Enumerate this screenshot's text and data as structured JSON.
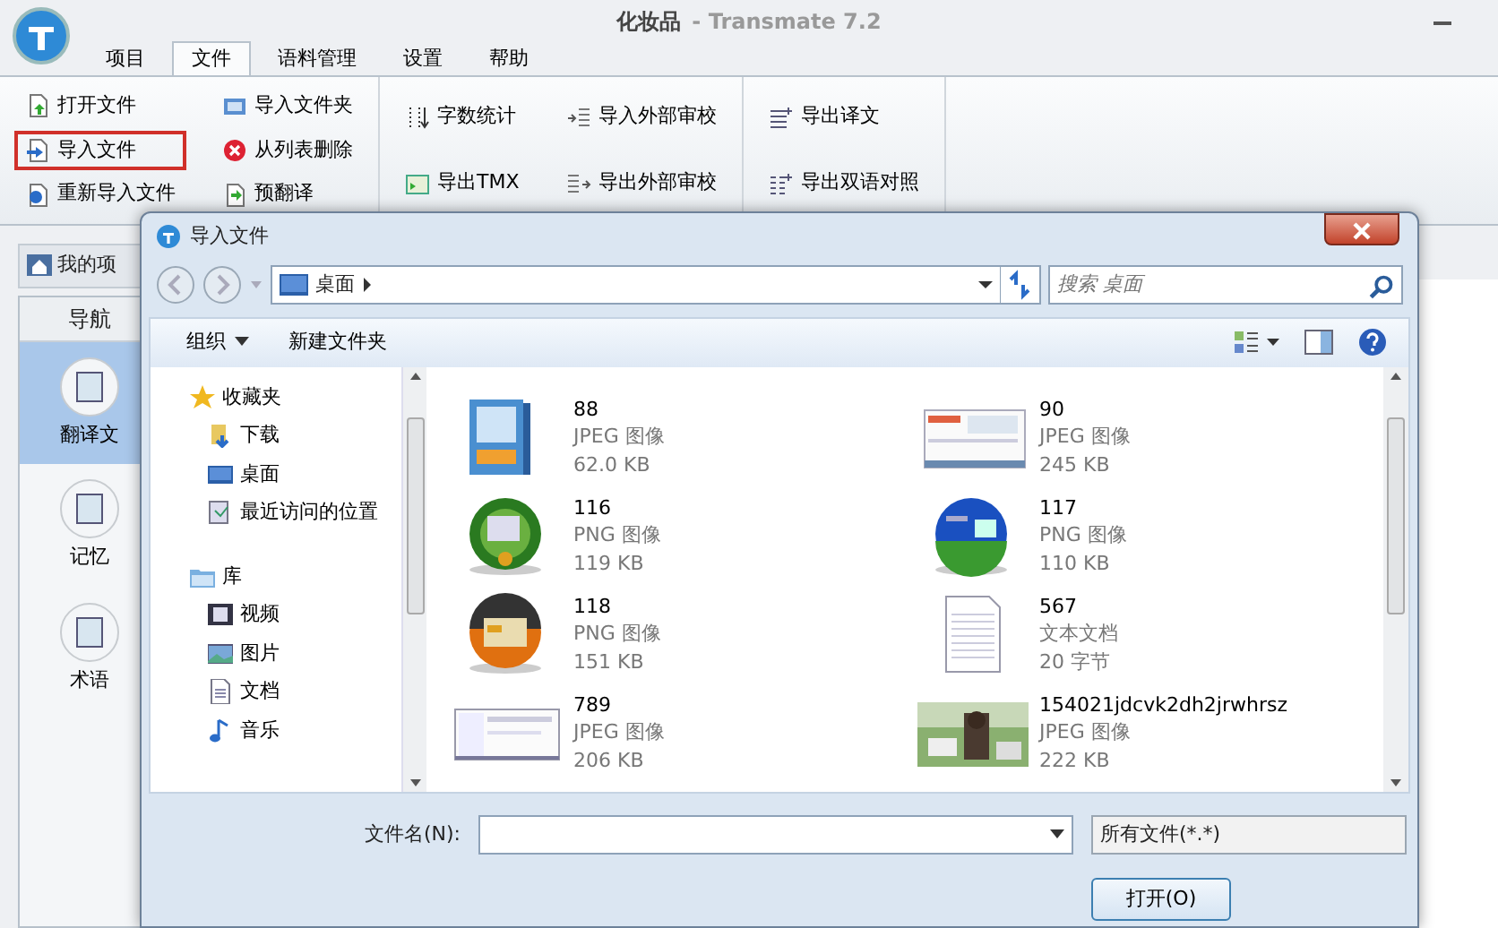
{
  "window": {
    "title": "化妆品",
    "app_name": "- Transmate 7.2"
  },
  "ribbon_tabs": [
    {
      "label": "项目",
      "selected": false
    },
    {
      "label": "文件",
      "selected": true
    },
    {
      "label": "语料管理",
      "selected": false
    },
    {
      "label": "设置",
      "selected": false
    },
    {
      "label": "帮助",
      "selected": false
    }
  ],
  "ribbon_groups": [
    {
      "columns": [
        [
          {
            "label": "打开文件",
            "highlighted": false
          },
          {
            "label": "导入文件",
            "highlighted": true
          },
          {
            "label": "重新导入文件",
            "highlighted": false
          }
        ],
        [
          {
            "label": "导入文件夹",
            "highlighted": false
          },
          {
            "label": "从列表删除",
            "highlighted": false
          },
          {
            "label": "预翻译",
            "highlighted": false
          }
        ]
      ]
    },
    {
      "columns": [
        [
          {
            "label": "字数统计",
            "highlighted": false
          },
          {
            "label": "导出TMX",
            "highlighted": false
          }
        ],
        [
          {
            "label": "导入外部审校",
            "highlighted": false
          },
          {
            "label": "导出外部审校",
            "highlighted": false
          }
        ]
      ]
    },
    {
      "columns": [
        [
          {
            "label": "导出译文",
            "highlighted": false
          },
          {
            "label": "导出双语对照",
            "highlighted": false
          }
        ]
      ]
    }
  ],
  "left_panel": {
    "tab": "我的项",
    "header": "导航",
    "items": [
      {
        "label": "翻译文",
        "selected": true
      },
      {
        "label": "记忆",
        "selected": false
      },
      {
        "label": "术语",
        "selected": false
      }
    ]
  },
  "dialog": {
    "title": "导入文件",
    "address": "桌面",
    "search": {
      "placeholder": "搜索 桌面"
    },
    "toolbar": [
      "组织",
      "新建文件夹"
    ],
    "nav_tree": [
      {
        "label": "收藏夹",
        "children": [
          {
            "label": "下载"
          },
          {
            "label": "桌面"
          },
          {
            "label": "最近访问的位置"
          }
        ]
      },
      {
        "label": "库",
        "children": [
          {
            "label": "视频"
          },
          {
            "label": "图片"
          },
          {
            "label": "文档"
          },
          {
            "label": "音乐"
          }
        ]
      }
    ],
    "files": [
      {
        "name": "88",
        "type": "JPEG 图像",
        "size": "62.0 KB",
        "kind": "picture"
      },
      {
        "name": "90",
        "type": "JPEG 图像",
        "size": "245 KB",
        "kind": "picture"
      },
      {
        "name": "116",
        "type": "PNG 图像",
        "size": "119 KB",
        "kind": "picture"
      },
      {
        "name": "117",
        "type": "PNG 图像",
        "size": "110 KB",
        "kind": "picture"
      },
      {
        "name": "118",
        "type": "PNG 图像",
        "size": "151 KB",
        "kind": "picture"
      },
      {
        "name": "567",
        "type": "文本文档",
        "size": "20 字节",
        "kind": "document"
      },
      {
        "name": "789",
        "type": "JPEG 图像",
        "size": "206 KB",
        "kind": "picture"
      },
      {
        "name": "154021jdcvk2dh2jrwhrsz",
        "type": "JPEG 图像",
        "size": "222 KB",
        "kind": "picture"
      }
    ],
    "filename_label": "文件名(N):",
    "file_filter": "所有文件(*.*)",
    "open_button": "打开(O)"
  }
}
